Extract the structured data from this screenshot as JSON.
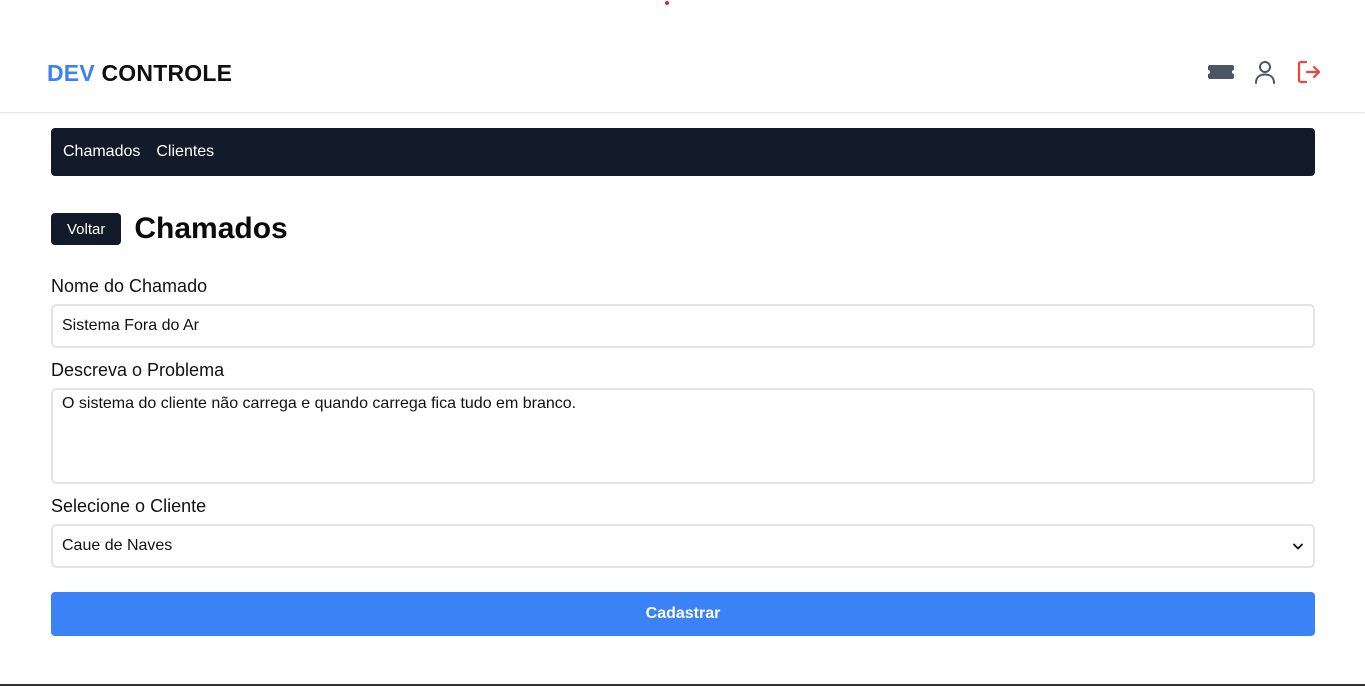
{
  "header": {
    "brand_accent": "DEV",
    "brand_rest": " CONTROLE",
    "icons": [
      "ticket-icon",
      "user-icon",
      "logout-icon"
    ],
    "colors": {
      "accent": "#3b82f6",
      "logout": "#ef4444",
      "dark": "#131a29"
    }
  },
  "nav": {
    "items": [
      {
        "label": "Chamados"
      },
      {
        "label": "Clientes"
      }
    ]
  },
  "page": {
    "back_label": "Voltar",
    "title": "Chamados"
  },
  "form": {
    "name_label": "Nome do Chamado",
    "name_value": "Sistema Fora do Ar",
    "desc_label": "Descreva o Problema",
    "desc_value": "O sistema do cliente não carrega e quando carrega fica tudo em branco.",
    "client_label": "Selecione o Cliente",
    "client_value": "Caue de Naves",
    "submit_label": "Cadastrar"
  }
}
